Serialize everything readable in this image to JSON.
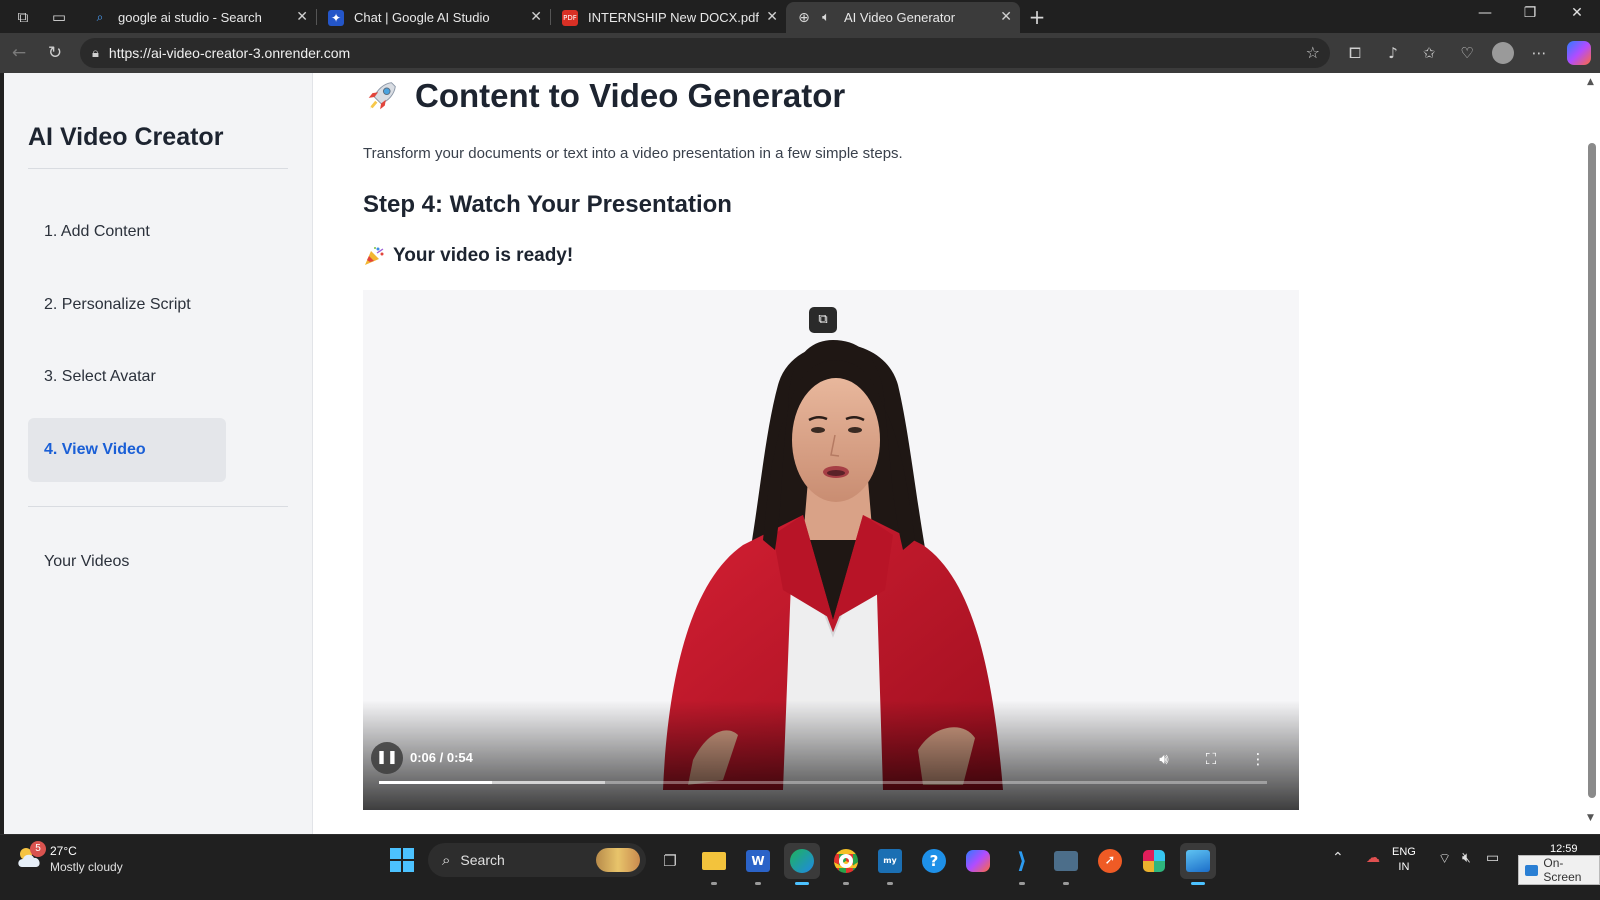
{
  "browser": {
    "tabs": [
      {
        "title": "google ai studio - Search",
        "icon": "search-favicon",
        "active": false
      },
      {
        "title": "Chat | Google AI Studio",
        "icon": "ai-studio-favicon",
        "active": false
      },
      {
        "title": "INTERNSHIP New DOCX.pdf",
        "icon": "pdf-favicon",
        "active": false
      },
      {
        "title": "AI Video Generator",
        "icon": "globe-favicon",
        "active": true
      }
    ],
    "url": "https://ai-video-creator-3.onrender.com"
  },
  "sidebar": {
    "brand": "AI Video Creator",
    "steps": [
      {
        "label": "1. Add Content",
        "active": false
      },
      {
        "label": "2. Personalize Script",
        "active": false
      },
      {
        "label": "3. Select Avatar",
        "active": false
      },
      {
        "label": "4. View Video",
        "active": true
      }
    ],
    "library_link": "Your Videos"
  },
  "main": {
    "title": "Content to Video Generator",
    "subtitle": "Transform your documents or text into a video presentation in a few simple steps.",
    "step_heading": "Step 4: Watch Your Presentation",
    "status": "Your video is ready!"
  },
  "player": {
    "time": "0:06 / 0:54",
    "played_fraction": 0.127,
    "buffered_fraction": 0.254,
    "state": "playing"
  },
  "taskbar": {
    "weather_badge": "5",
    "temperature": "27°C",
    "condition": "Mostly cloudy",
    "search_placeholder": "Search",
    "language": "ENG",
    "region": "IN",
    "time": "12:59",
    "osk_label": "On-Screen"
  },
  "colors": {
    "accent": "#1a5fd6",
    "sidebar_bg": "#f3f4f6",
    "blazer": "#c8162b"
  }
}
